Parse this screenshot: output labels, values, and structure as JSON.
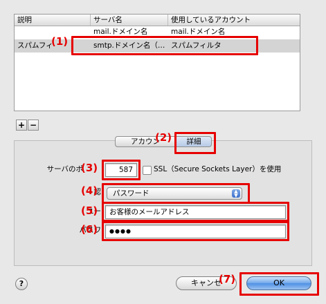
{
  "table": {
    "headers": [
      "説明",
      "サーバ名",
      "使用しているアカウント"
    ],
    "rows": [
      {
        "desc": "",
        "server": "mail.ドメイン名",
        "account": "mail.ドメイン名"
      },
      {
        "desc": "スパムフィ",
        "server": "smtp.ドメイン名（…",
        "account": "スパムフィルタ"
      }
    ]
  },
  "list_buttons": {
    "add": "+",
    "remove": "−"
  },
  "tabs": {
    "account": "アカウン",
    "detail": "詳細"
  },
  "form": {
    "port_label": "サーバのポ",
    "port_value": "587",
    "ssl_label": "SSL（Secure Sockets Layer）を使用",
    "ssl_checked": false,
    "auth_label": "認",
    "auth_value": "パスワード",
    "user_label": "ユー",
    "user_value": "お客様のメールアドレス",
    "password_label": "パスワ",
    "password_value": "●●●●"
  },
  "footer": {
    "help": "?",
    "cancel": "キャンセ",
    "ok": "OK"
  },
  "callouts": [
    "(1)",
    "(2)",
    "(3)",
    "(4)",
    "(5)",
    "(6)",
    "(7)"
  ],
  "colors": {
    "callout": "#e60000",
    "selection_row": "#d4d4d4",
    "ok_button": "#4e8fe3"
  }
}
